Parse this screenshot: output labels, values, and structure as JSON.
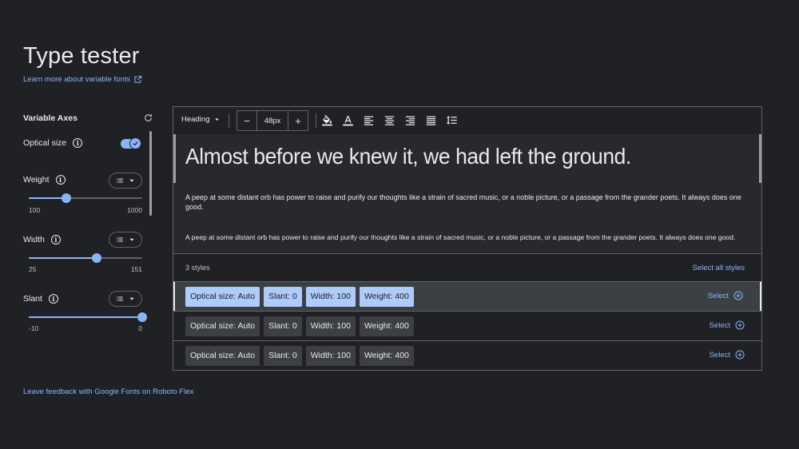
{
  "page": {
    "title": "Type tester",
    "learn_more_link": "Learn more about variable fonts",
    "feedback_link": "Leave feedback with Google Fonts on Roboto Flex"
  },
  "axes": {
    "header": "Variable Axes",
    "optical_size": {
      "label": "Optical size",
      "enabled": true
    },
    "weight": {
      "label": "Weight",
      "min": "100",
      "max": "1000",
      "value_fraction": 0.33
    },
    "width": {
      "label": "Width",
      "min": "25",
      "max": "151",
      "value_fraction": 0.6
    },
    "slant": {
      "label": "Slant",
      "min": "-10",
      "max": "0",
      "value_fraction": 1.0
    }
  },
  "toolbar": {
    "style_select": "Heading",
    "decrease": "−",
    "size": "48px",
    "increase": "+"
  },
  "preview": {
    "heading": "Almost before we knew it, we had left the ground.",
    "body1": "A peep at some distant orb has power to raise and purify our thoughts like a strain of sacred music, or a noble picture, or a passage from the grander poets. It always does one good.",
    "body2": "A peep at some distant orb has power to raise and purify our thoughts like a strain of sacred music, or a noble picture, or a passage from the grander poets. It always does one good."
  },
  "styles": {
    "count_label": "3 styles",
    "select_all": "Select all styles",
    "select_label": "Select",
    "rows": [
      {
        "optical": "Optical size: Auto",
        "slant": "Slant: 0",
        "width": "Width: 100",
        "weight": "Weight: 400",
        "selected": true
      },
      {
        "optical": "Optical size: Auto",
        "slant": "Slant: 0",
        "width": "Width: 100",
        "weight": "Weight: 400",
        "selected": false
      },
      {
        "optical": "Optical size: Auto",
        "slant": "Slant: 0",
        "width": "Width: 100",
        "weight": "Weight: 400",
        "selected": false
      }
    ]
  },
  "colors": {
    "accent": "#8ab4f8",
    "background": "#202124",
    "chip_selected": "#aecbfa"
  }
}
